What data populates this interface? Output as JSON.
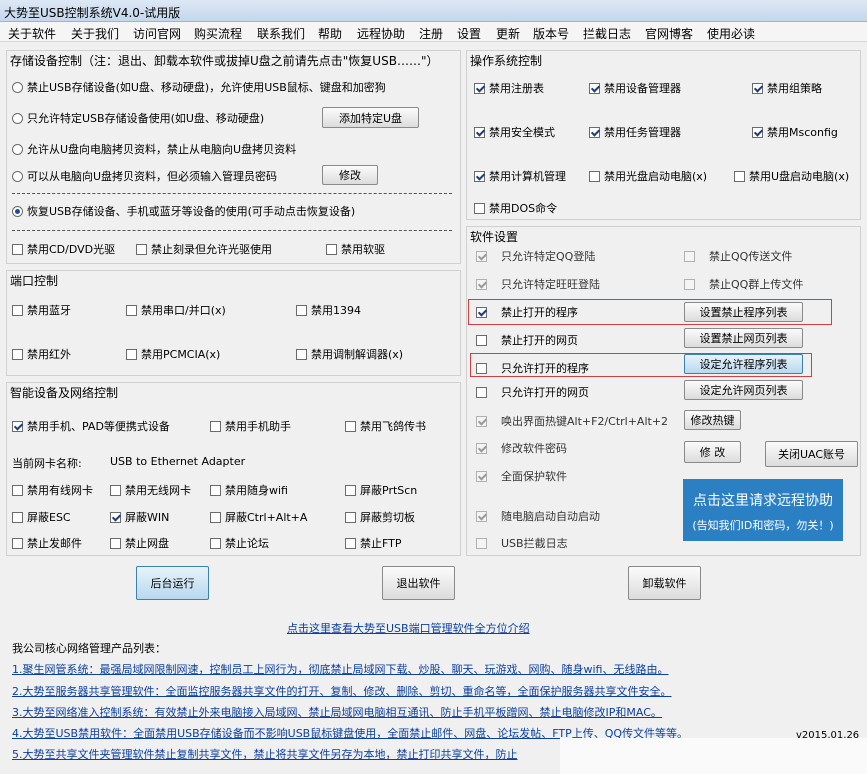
{
  "window": {
    "title": "大势至USB控制系统V4.0-试用版"
  },
  "menu": [
    "关于软件",
    "关于我们",
    "访问官网",
    "购买流程",
    "联系我们",
    "帮助",
    "远程协助",
    "注册",
    "设置",
    "更新",
    "版本号",
    "拦截日志",
    "官网博客",
    "使用必读"
  ],
  "storage": {
    "title": "存储设备控制（注：退出、卸载本软件或拔掉U盘之前请先点击\"恢复USB……\"）",
    "options": [
      {
        "label": "禁止USB存储设备(如U盘、移动硬盘)，允许使用USB鼠标、键盘和加密狗",
        "selected": false
      },
      {
        "label": "只允许特定USB存储设备使用(如U盘、移动硬盘)",
        "selected": false
      },
      {
        "label": "允许从U盘向电脑拷贝资料，禁止从电脑向U盘拷贝资料",
        "selected": false
      },
      {
        "label": "可以从电脑向U盘拷贝资料，但必须输入管理员密码",
        "selected": false
      },
      {
        "label": "恢复USB存储设备、手机或蓝牙等设备的使用(可手动点击恢复设备)",
        "selected": true
      }
    ],
    "add_btn": "添加特定U盘",
    "modify_btn": "修改",
    "checks": [
      {
        "label": "禁用CD/DVD光驱",
        "checked": false
      },
      {
        "label": "禁止刻录但允许光驱使用",
        "checked": false
      },
      {
        "label": "禁用软驱",
        "checked": false
      }
    ]
  },
  "port": {
    "title": "端口控制",
    "checks": [
      {
        "label": "禁用蓝牙",
        "checked": false
      },
      {
        "label": "禁用串口/并口(x)",
        "checked": false
      },
      {
        "label": "禁用1394",
        "checked": false
      },
      {
        "label": "禁用红外",
        "checked": false
      },
      {
        "label": "禁用PCMCIA(x)",
        "checked": false
      },
      {
        "label": "禁用调制解调器(x)",
        "checked": false
      }
    ]
  },
  "smart": {
    "title": "智能设备及网络控制",
    "checks": [
      {
        "label": "禁用手机、PAD等便携式设备",
        "checked": true
      },
      {
        "label": "禁用手机助手",
        "checked": false
      },
      {
        "label": "禁用飞鸽传书",
        "checked": false
      }
    ],
    "nic_label": "当前网卡名称:",
    "nic_value": "USB to Ethernet Adapter",
    "net_checks": [
      {
        "label": "禁用有线网卡",
        "checked": false
      },
      {
        "label": "禁用无线网卡",
        "checked": false
      },
      {
        "label": "禁用随身wifi",
        "checked": false
      },
      {
        "label": "屏蔽PrtScn",
        "checked": false
      },
      {
        "label": "屏蔽ESC",
        "checked": false
      },
      {
        "label": "屏蔽WIN",
        "checked": true
      },
      {
        "label": "屏蔽Ctrl+Alt+A",
        "checked": false
      },
      {
        "label": "屏蔽剪切板",
        "checked": false
      },
      {
        "label": "禁止发邮件",
        "checked": false
      },
      {
        "label": "禁止网盘",
        "checked": false
      },
      {
        "label": "禁止论坛",
        "checked": false
      },
      {
        "label": "禁止FTP",
        "checked": false
      }
    ]
  },
  "os": {
    "title": "操作系统控制",
    "checks": [
      {
        "label": "禁用注册表",
        "checked": true
      },
      {
        "label": "禁用设备管理器",
        "checked": true
      },
      {
        "label": "禁用组策略",
        "checked": true
      },
      {
        "label": "禁用安全模式",
        "checked": true
      },
      {
        "label": "禁用任务管理器",
        "checked": true
      },
      {
        "label": "禁用Msconfig",
        "checked": true
      },
      {
        "label": "禁用计算机管理",
        "checked": true
      },
      {
        "label": "禁用光盘启动电脑(x)",
        "checked": false
      },
      {
        "label": "禁用U盘启动电脑(x)",
        "checked": false
      },
      {
        "label": "禁用DOS命令",
        "checked": false
      }
    ]
  },
  "software": {
    "title": "软件设置",
    "items": [
      {
        "label": "只允许特定QQ登陆",
        "checked": true,
        "disabled": true
      },
      {
        "label": "禁止QQ传送文件",
        "checked": false,
        "disabled": true
      },
      {
        "label": "只允许特定旺旺登陆",
        "checked": true,
        "disabled": true
      },
      {
        "label": "禁止QQ群上传文件",
        "checked": false,
        "disabled": true
      },
      {
        "label": "禁止打开的程序",
        "checked": true,
        "disabled": false
      },
      {
        "label": "禁止打开的网页",
        "checked": false,
        "disabled": false
      },
      {
        "label": "只允许打开的程序",
        "checked": false,
        "disabled": false
      },
      {
        "label": "只允许打开的网页",
        "checked": false,
        "disabled": false
      },
      {
        "label": "唤出界面热键Alt+F2/Ctrl+Alt+2",
        "checked": true,
        "disabled": true
      },
      {
        "label": "修改软件密码",
        "checked": true,
        "disabled": true
      },
      {
        "label": "全面保护软件",
        "checked": true,
        "disabled": true
      },
      {
        "label": "随电脑启动自动启动",
        "checked": true,
        "disabled": true
      },
      {
        "label": "USB拦截日志",
        "checked": false,
        "disabled": true
      }
    ],
    "btn_block_prog": "设置禁止程序列表",
    "btn_block_web": "设置禁止网页列表",
    "btn_allow_prog": "设定允许程序列表",
    "btn_allow_web": "设定允许网页列表",
    "btn_hotkey": "修改热键",
    "btn_modify": "修 改",
    "btn_uac": "关闭UAC账号",
    "remote_l1": "点击这里请求远程协助",
    "remote_l2": "(告知我们ID和密码，勿关！)"
  },
  "actions": {
    "bg": "后台运行",
    "exit": "退出软件",
    "uninstall": "卸载软件"
  },
  "footer": {
    "intro_link": "点击这里查看大势至USB端口管理软件全方位介绍",
    "products_title": "我公司核心网络管理产品列表：",
    "products": [
      "1.聚生网管系统：最强局域网限制网速，控制员工上网行为，彻底禁止局域网下载、炒股、聊天、玩游戏、网购、随身wifi、无线路由。",
      "2.大势至服务器共享管理软件：全面监控服务器共享文件的打开、复制、修改、删除、剪切、重命名等，全面保护服务器共享文件安全。",
      "3.大势至网络准入控制系统：有效禁止外来电脑接入局域网、禁止局域网电脑相互通讯、防止手机平板蹭网、禁止电脑修改IP和MAC。",
      "4.大势至USB禁用软件：全面禁用USB存储设备而不影响USB鼠标键盘使用，全面禁止邮件、网盘、论坛发帖、FTP上传、QQ传文件等等。",
      "5.大势至共享文件夹管理软件禁止复制共享文件，禁止将共享文件另存为本地，禁止打印共享文件，防止"
    ],
    "version_date": "v2015.01.26"
  },
  "colors": {
    "accent": "#2b7fc3",
    "highlight_box": "#d04040",
    "link": "#0b3fa0"
  }
}
